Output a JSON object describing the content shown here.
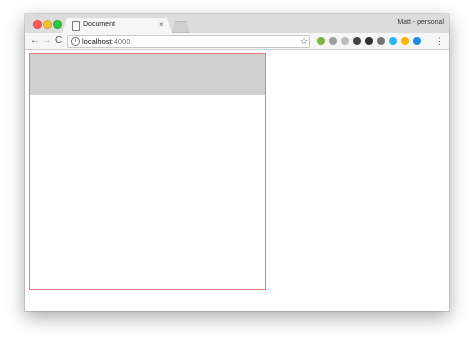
{
  "window": {
    "tab": {
      "title": "Document",
      "close_glyph": "×",
      "icon": "document-icon"
    },
    "profile_name": "Matt - personal"
  },
  "toolbar": {
    "back_glyph": "←",
    "forward_glyph": "→",
    "reload_glyph": "C",
    "address": {
      "host": "localhost",
      "port": ":4000",
      "info_glyph": "i"
    },
    "bookmark_glyph": "☆",
    "menu_glyph": "⋮",
    "extensions": [
      {
        "name": "green-extension-icon",
        "color": "#7cb342"
      },
      {
        "name": "info-extension-icon",
        "color": "#9e9e9e"
      },
      {
        "name": "shield-extension-icon",
        "color": "#bdbdbd"
      },
      {
        "name": "download-extension-icon",
        "color": "#424242"
      },
      {
        "name": "circle-dark-extension-icon",
        "color": "#303030"
      },
      {
        "name": "globe-gray-extension-icon",
        "color": "#757575"
      },
      {
        "name": "blue-extension-icon",
        "color": "#29b6f6"
      },
      {
        "name": "play-extension-icon",
        "color": "#ffb300"
      },
      {
        "name": "blue-globe-extension-icon",
        "color": "#1e88e5"
      }
    ]
  },
  "page": {
    "box_border_color": "#e57c7c",
    "band_color": "#cfcfcf"
  }
}
